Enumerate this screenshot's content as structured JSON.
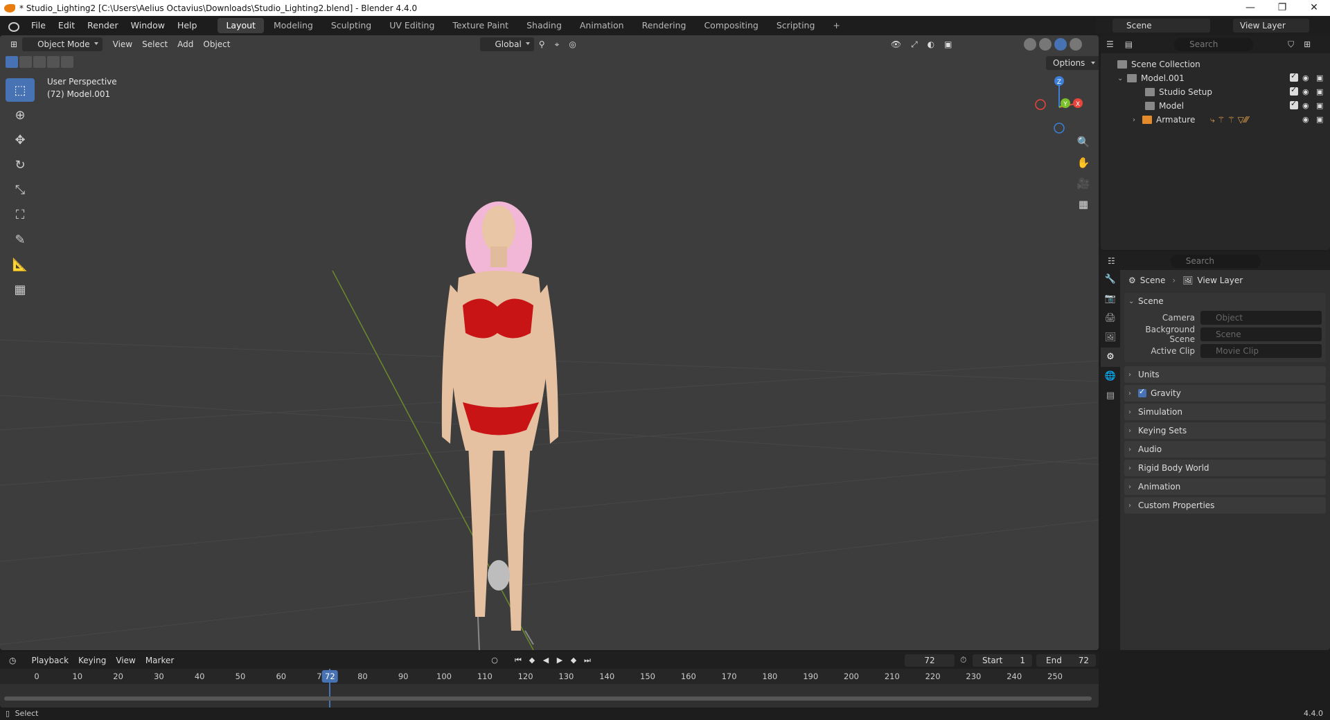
{
  "window": {
    "title": "* Studio_Lighting2 [C:\\Users\\Aelius Octavius\\Downloads\\Studio_Lighting2.blend] - Blender 4.4.0",
    "controls": [
      "—",
      "❐",
      "✕"
    ]
  },
  "menu": [
    "File",
    "Edit",
    "Render",
    "Window",
    "Help"
  ],
  "workspaces": [
    "Layout",
    "Modeling",
    "Sculpting",
    "UV Editing",
    "Texture Paint",
    "Shading",
    "Animation",
    "Rendering",
    "Compositing",
    "Scripting",
    "+"
  ],
  "active_workspace": "Layout",
  "scene_selector": "Scene",
  "view_layer_selector": "View Layer",
  "viewport": {
    "mode": "Object Mode",
    "menus": [
      "View",
      "Select",
      "Add",
      "Object"
    ],
    "orientation": "Global",
    "options_label": "Options",
    "overlay_line1": "User Perspective",
    "overlay_line2": "(72) Model.001",
    "gizmo_axes": [
      "Z",
      "Y",
      "X"
    ],
    "tools": [
      "select-box-icon",
      "cursor-icon",
      "move-icon",
      "rotate-icon",
      "scale-icon",
      "transform-icon",
      "annotate-icon",
      "measure-icon",
      "add-cube-icon"
    ],
    "nav_buttons": [
      "zoom-icon",
      "pan-hand-icon",
      "camera-view-icon",
      "ortho-grid-icon"
    ]
  },
  "outliner": {
    "search_placeholder": "Search",
    "rows": [
      {
        "label": "Scene Collection",
        "indent": 0
      },
      {
        "label": "Model.001",
        "indent": 1
      },
      {
        "label": "Studio Setup",
        "indent": 2
      },
      {
        "label": "Model",
        "indent": 2
      },
      {
        "label": "Armature",
        "indent": 2
      }
    ]
  },
  "properties": {
    "search_placeholder": "Search",
    "breadcrumb_scene": "Scene",
    "breadcrumb_view_layer": "View Layer",
    "scene_panel_title": "Scene",
    "fields": [
      {
        "label": "Camera",
        "placeholder": "Object"
      },
      {
        "label": "Background Scene",
        "placeholder": "Scene"
      },
      {
        "label": "Active Clip",
        "placeholder": "Movie Clip"
      }
    ],
    "sections": [
      "Units",
      "Gravity",
      "Simulation",
      "Keying Sets",
      "Audio",
      "Rigid Body World",
      "Animation",
      "Custom Properties"
    ]
  },
  "timeline": {
    "menus": [
      "Playback",
      "Keying",
      "View",
      "Marker"
    ],
    "current_frame": "72",
    "start_label": "Start",
    "start_value": "1",
    "end_label": "End",
    "end_value": "72",
    "ruler_ticks": [
      "0",
      "10",
      "20",
      "30",
      "40",
      "50",
      "60",
      "70",
      "80",
      "90",
      "100",
      "110",
      "120",
      "130",
      "140",
      "150",
      "160",
      "170",
      "180",
      "190",
      "200",
      "210",
      "220",
      "230",
      "240",
      "250"
    ],
    "playhead_frame": 72
  },
  "status": {
    "left": "Select",
    "version": "4.4.0"
  },
  "colors": {
    "accent": "#4772b3",
    "viewport_bg": "#3d3d3d",
    "axis_x": "#e8453c",
    "axis_y": "#7bbf2a",
    "axis_z": "#3d7fd6"
  }
}
